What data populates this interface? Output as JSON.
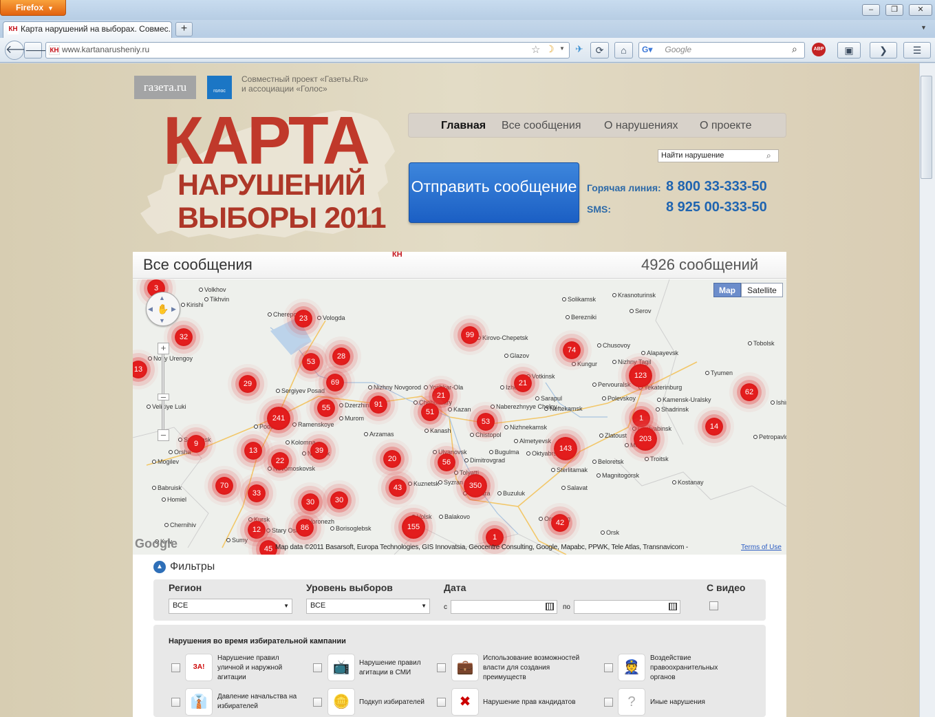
{
  "browser": {
    "menu_button": "Firefox",
    "tab_title": "Карта нарушений на выборах. Совмес...",
    "favicon_text": "КН",
    "new_tab": "+",
    "url": "www.kartanarusheniy.ru",
    "search_placeholder": "Google",
    "window_buttons": [
      "–",
      "❐",
      "✕"
    ]
  },
  "header": {
    "gazeta": "газета.ru",
    "golos": "голос",
    "project_line1": "Совместный проект «Газеты.Ru»",
    "project_line2": "и ассоциации «Голос»",
    "logo_line1": "КАРТА",
    "logo_line2": "НАРУШЕНИЙ",
    "logo_line3": "ВЫБОРЫ 2011",
    "menu": [
      "Главная",
      "Все сообщения",
      "О нарушениях",
      "О проекте"
    ],
    "find_placeholder": "Найти нарушение",
    "send_button": "Отправить сообщение",
    "hotline_label": "Горячая линия:",
    "hotline_number": "8 800 33-333-50",
    "sms_label": "SMS:",
    "sms_number": "8 925 00-333-50"
  },
  "map_panel": {
    "title": "Все сообщения",
    "count": "4926 сообщений",
    "mark": "КН",
    "map_type": [
      "Map",
      "Satellite"
    ],
    "attribution": "Map data ©2011 Basarsoft, Europa Technologies, GIS Innovatsia, Geocentre Consulting, Google, Mapabc, PPWK, Tele Atlas, Transnavicom -",
    "terms": "Terms of Use",
    "google": "Google",
    "clusters": [
      "3",
      "23",
      "32",
      "99",
      "74",
      "28",
      "53",
      "13",
      "69",
      "123",
      "29",
      "21",
      "21",
      "62",
      "91",
      "51",
      "241",
      "55",
      "53",
      "1",
      "14",
      "9",
      "13",
      "39",
      "22",
      "20",
      "56",
      "143",
      "203",
      "70",
      "33",
      "43",
      "350",
      "30",
      "30",
      "12",
      "86",
      "155",
      "42",
      "1",
      "45"
    ],
    "cities": [
      "Volkhov",
      "Tikhvin",
      "Kirishi",
      "Cherepovets",
      "Vologda",
      "Kirovo-Chepetsk",
      "Glazov",
      "Solikamsk",
      "Krasnoturinsk",
      "Berezniki",
      "Serov",
      "Chusovoy",
      "Alapayevsk",
      "Nizhny Tagil",
      "Tobolsk",
      "Tyumen",
      "Pervouralsk",
      "Yekaterinburg",
      "Polevskoy",
      "Kamensk-Uralsky",
      "Shadrinsk",
      "Kungur",
      "Votkinsk",
      "Izhevsk",
      "Sarapul",
      "Neftekamsk",
      "Naberezhnyye Chelny",
      "Nizhnekamsk",
      "Almetyevsk",
      "Chistopol",
      "Kazan",
      "Kanash",
      "Yoshkar-Ola",
      "Cheboksary",
      "Nizhny Novgorod",
      "Dzerzhinsk",
      "Murom",
      "Arzamas",
      "Sergiyev Posad",
      "Podolsk",
      "Ramenskoye",
      "Kolomna",
      "Noginsk",
      "Novomoskovsk",
      "Mogilev",
      "Orsha",
      "Smolensk",
      "Babruisk",
      "Homiel",
      "Chernihiv",
      "Kyiv",
      "Sumy",
      "Kursk",
      "Stary Oskol",
      "Borisoglebsk",
      "Voronezh",
      "Balakovo",
      "Volsk",
      "Syzran",
      "Tolyatti",
      "Samara",
      "Kuznetsk",
      "Ulyanovsk",
      "Dimitrovgrad",
      "Bugulma",
      "Oktyabrsky",
      "Sterlitamak",
      "Salavat",
      "Buzuluk",
      "Orenburg",
      "Orsk",
      "Beloretsk",
      "Magnitogorsk",
      "Kostanay",
      "Troitsk",
      "Miass",
      "Chelyabinsk",
      "Zlatoust",
      "Petropavlovsk",
      "Ishim",
      "Novy Urengoy",
      "Velikiye Luki"
    ]
  },
  "filters": {
    "title": "Фильтры",
    "region_label": "Регион",
    "region_value": "ВСЕ",
    "level_label": "Уровень выборов",
    "level_value": "ВСЕ",
    "date_label": "Дата",
    "date_from": "с",
    "date_to": "по",
    "video_label": "С видео",
    "categories_title": "Нарушения во время избирательной кампании",
    "categories": [
      "Нарушение правил уличной и наружной агитации",
      "Нарушение правил агитации в СМИ",
      "Использование возможностей власти для создания преимуществ",
      "Воздействие правоохранительных органов",
      "Давление начальства на избирателей",
      "Подкуп избирателей",
      "Нарушение прав кандидатов",
      "Иные нарушения"
    ]
  },
  "colors": {
    "accent": "#c0392b",
    "button": "#2a6fd0",
    "link": "#1f64b0",
    "cluster": "#e31d1d"
  }
}
